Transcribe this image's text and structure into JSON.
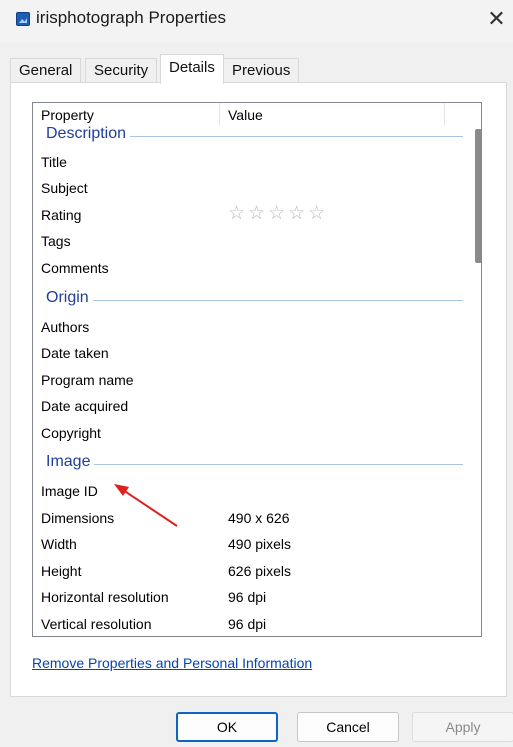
{
  "window": {
    "title": "irisphotograph Properties",
    "close_glyph": "✕",
    "icon": "image-file-icon"
  },
  "tabs": [
    {
      "label": "General"
    },
    {
      "label": "Security"
    },
    {
      "label": "Details",
      "active": true
    },
    {
      "label": "Previous Versions"
    }
  ],
  "details": {
    "header": {
      "property": "Property",
      "value": "Value"
    },
    "groups": {
      "description": {
        "label": "Description",
        "rows": [
          {
            "name": "Title",
            "value": ""
          },
          {
            "name": "Subject",
            "value": ""
          },
          {
            "name": "Rating",
            "value": "☆☆☆☆☆"
          },
          {
            "name": "Tags",
            "value": ""
          },
          {
            "name": "Comments",
            "value": ""
          }
        ]
      },
      "origin": {
        "label": "Origin",
        "rows": [
          {
            "name": "Authors",
            "value": ""
          },
          {
            "name": "Date taken",
            "value": ""
          },
          {
            "name": "Program name",
            "value": ""
          },
          {
            "name": "Date acquired",
            "value": ""
          },
          {
            "name": "Copyright",
            "value": ""
          }
        ]
      },
      "image": {
        "label": "Image",
        "rows": [
          {
            "name": "Image ID",
            "value": ""
          },
          {
            "name": "Dimensions",
            "value": "490 x 626"
          },
          {
            "name": "Width",
            "value": "490 pixels"
          },
          {
            "name": "Height",
            "value": "626 pixels"
          },
          {
            "name": "Horizontal resolution",
            "value": "96 dpi"
          },
          {
            "name": "Vertical resolution",
            "value": "96 dpi"
          }
        ]
      }
    }
  },
  "link": "Remove Properties and Personal Information",
  "buttons": {
    "ok": "OK",
    "cancel": "Cancel",
    "apply": "Apply"
  },
  "colors": {
    "group_heading": "#1f3f9a",
    "link": "#0645ad",
    "annotation_arrow": "#e02020",
    "ok_border": "#0a66c2"
  }
}
